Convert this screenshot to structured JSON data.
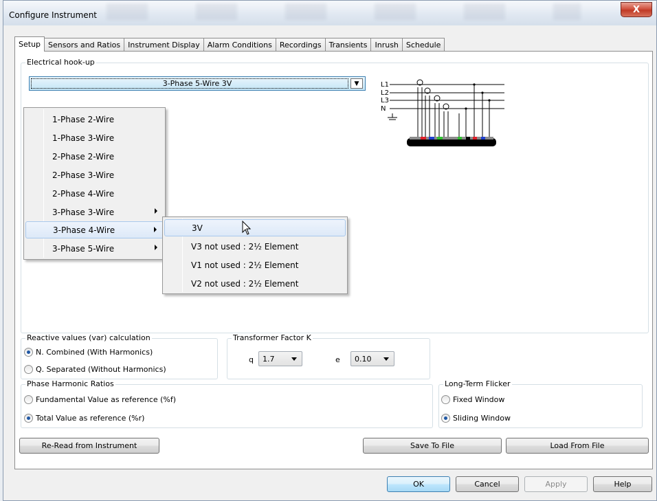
{
  "window": {
    "title": "Configure Instrument",
    "close_label": "X"
  },
  "tabs": [
    {
      "label": "Setup"
    },
    {
      "label": "Sensors and Ratios"
    },
    {
      "label": "Instrument Display"
    },
    {
      "label": "Alarm Conditions"
    },
    {
      "label": "Recordings"
    },
    {
      "label": "Transients"
    },
    {
      "label": "Inrush"
    },
    {
      "label": "Schedule"
    }
  ],
  "hookup": {
    "group_label": "Electrical hook-up",
    "selected": "3-Phase 5-Wire 3V",
    "menu": [
      {
        "label": "1-Phase 2-Wire"
      },
      {
        "label": "1-Phase 3-Wire"
      },
      {
        "label": "2-Phase 2-Wire"
      },
      {
        "label": "2-Phase 3-Wire"
      },
      {
        "label": "2-Phase 4-Wire"
      },
      {
        "label": "3-Phase 3-Wire"
      },
      {
        "label": "3-Phase 4-Wire"
      },
      {
        "label": "3-Phase 5-Wire"
      }
    ],
    "submenu": [
      {
        "label": "3V"
      },
      {
        "label": "V3 not used : 2½ Element"
      },
      {
        "label": "V1 not used : 2½ Element"
      },
      {
        "label": "V2 not used : 2½ Element"
      }
    ],
    "diagram_labels": {
      "l1": "L1",
      "l2": "L2",
      "l3": "L3",
      "n": "N"
    }
  },
  "reactive": {
    "group_label": "Reactive values (var) calculation",
    "option_combined": "N. Combined (With Harmonics)",
    "option_separated": "Q. Separated (Without Harmonics)",
    "selected": "combined"
  },
  "transformer": {
    "group_label": "Transformer Factor K",
    "q_label": "q",
    "q_value": "1.7",
    "e_label": "e",
    "e_value": "0.10"
  },
  "harmonic": {
    "group_label": "Phase Harmonic Ratios",
    "option_fundamental": "Fundamental Value as reference (%f)",
    "option_total": "Total Value as reference (%r)",
    "selected": "total"
  },
  "flicker": {
    "group_label": "Long-Term Flicker",
    "option_fixed": "Fixed Window",
    "option_sliding": "Sliding Window",
    "selected": "sliding"
  },
  "buttons": {
    "reread": "Re-Read from Instrument",
    "save": "Save To File",
    "load": "Load From File",
    "ok": "OK",
    "cancel": "Cancel",
    "apply": "Apply",
    "help": "Help"
  },
  "colors": {
    "accent": "#3c7fb1",
    "red_wire": "#e0202a",
    "blue_wire": "#2040d0",
    "green_wire": "#30c030",
    "grey_wire": "#9a9a9a"
  }
}
